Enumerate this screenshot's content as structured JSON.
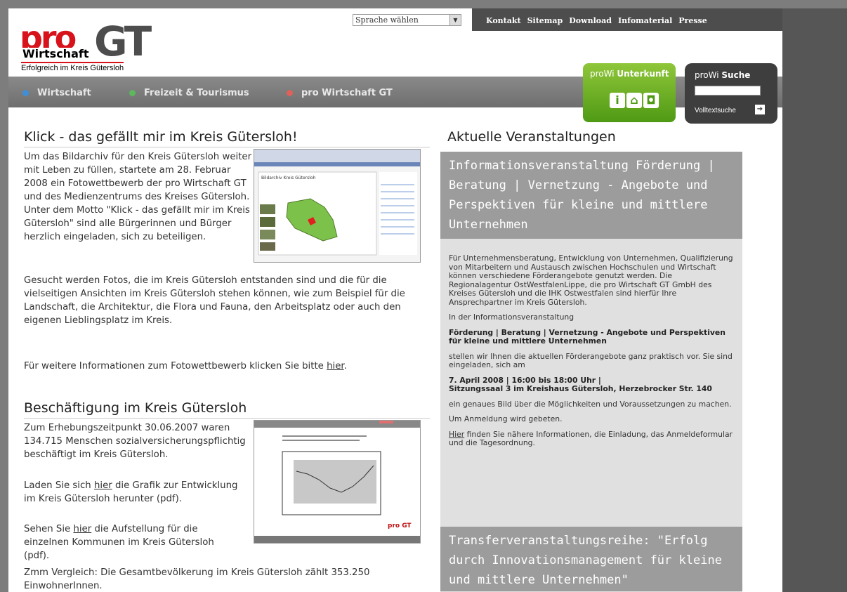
{
  "header": {
    "logo_pro": "pro",
    "logo_gt": "GT",
    "logo_wirtschaft": "Wirtschaft",
    "logo_tagline": "Erfolgreich im Kreis Gütersloh",
    "language_select": "Sprache wählen",
    "top_links": [
      "Kontakt",
      "Sitemap",
      "Download",
      "Infomaterial",
      "Presse"
    ]
  },
  "nav": {
    "items": [
      {
        "label": "Wirtschaft",
        "color": "#3f8fd8"
      },
      {
        "label": "Freizeit & Tourismus",
        "color": "#5cb85c"
      },
      {
        "label": "pro Wirtschaft GT",
        "color": "#e0605a"
      }
    ]
  },
  "unterkunft": {
    "prefix": "proWi",
    "label": "Unterkunft"
  },
  "suche": {
    "prefix": "proWi",
    "label": "Suche",
    "volltext": "Volltextsuche"
  },
  "article1": {
    "title": "Klick - das gefällt mir im Kreis Gütersloh!",
    "p1": "Um das Bildarchiv für den Kreis Gütersloh weiter mit Leben zu füllen, startete am 28. Februar 2008 ein Fotowettbewerb der pro Wirtschaft GT und des Medienzentrums des Kreises Gütersloh. Unter dem Motto \"Klick - das gefällt mir im Kreis Gütersloh\" sind alle Bürgerinnen und Bürger herzlich eingeladen, sich zu beteiligen.",
    "p2": "Gesucht werden Fotos, die im Kreis Gütersloh entstanden sind und die für die vielseitigen Ansichten im Kreis Gütersloh stehen können, wie zum Beispiel für die Landschaft, die Architektur, die Flora und Fauna, den Arbeitsplatz oder auch den eigenen Lieblingsplatz im Kreis.",
    "p3_pre": "Für weitere Informationen zum Fotowettbewerb klicken Sie bitte ",
    "p3_link": "hier",
    "p3_post": "."
  },
  "article2": {
    "title": "Beschäftigung im Kreis Gütersloh",
    "p1": "Zum Erhebungszeitpunkt 30.06.2007 waren 134.715 Menschen sozialversicherungspflichtig beschäftigt im Kreis Gütersloh.",
    "p2_pre": "Laden Sie sich ",
    "p2_link": "hier",
    "p2_post": " die Grafik zur Entwicklung im Kreis Gütersloh herunter (pdf).",
    "p3_pre": "Sehen Sie ",
    "p3_link": "hier",
    "p3_post": " die Aufstellung für die einzelnen Kommunen im Kreis Gütersloh (pdf).",
    "p4": "Zmm Vergleich: Die Gesamtbevölkerung im Kreis Gütersloh zählt 353.250 EinwohnerInnen."
  },
  "events": {
    "heading": "Aktuelle Veranstaltungen",
    "event1_title": "Informationsveranstaltung Förderung | Beratung | Vernetzung - Angebote und Perspektiven für kleine und mittlere Unternehmen",
    "e1_p1": "Für Unternehmensberatung, Entwicklung von Unternehmen, Qualifizierung von Mitarbeitern und Austausch zwischen Hochschulen und Wirtschaft können verschiedene Förderangebote genutzt werden. Die Regionalagentur OstWestfalenLippe, die pro Wirtschaft GT GmbH des Kreises Gütersloh und die IHK Ostwestfalen sind hierfür Ihre Ansprechpartner im Kreis Gütersloh.",
    "e1_p2": "In der Informationsveranstaltung",
    "e1_p3": "Förderung | Beratung | Vernetzung - Angebote und Perspektiven für kleine und mittlere Unternehmen",
    "e1_p4": "stellen wir Ihnen die aktuellen Förderangebote ganz praktisch vor. Sie sind eingeladen, sich am",
    "e1_p5a": "7. April 2008 | 16:00 bis 18:00 Uhr |",
    "e1_p5b": "Sitzungssaal 3 im Kreishaus Gütersloh, Herzebrocker Str. 140",
    "e1_p6": "ein genaues Bild über die Möglichkeiten und Voraussetzungen zu machen.",
    "e1_p7": "Um Anmeldung wird gebeten.",
    "e1_p8_link": "Hier",
    "e1_p8_post": " finden Sie nähere Informationen, die Einladung, das Anmeldeformular und die Tagesordnung.",
    "event2_title": "Transferveranstaltungsreihe: \"Erfolg durch Innovationsmanagement für kleine und mittlere Unternehmen\""
  },
  "thumb1_title": "Bildarchiv Kreis Gütersloh",
  "thumb2_logo": "pro GT"
}
